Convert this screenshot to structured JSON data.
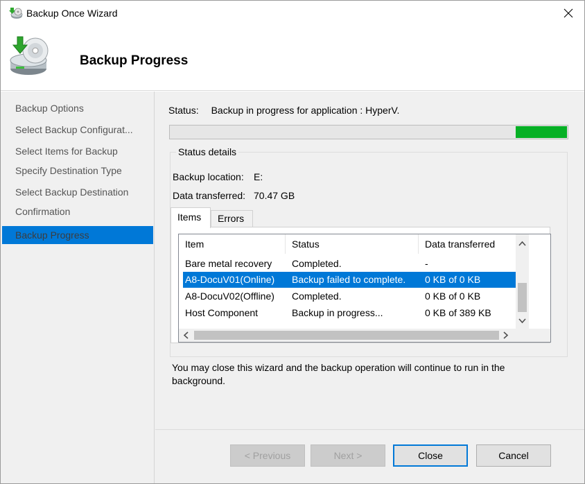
{
  "window": {
    "title": "Backup Once Wizard",
    "close_glyph": "✕"
  },
  "header": {
    "title": "Backup Progress",
    "icon": "backup-disk-icon"
  },
  "nav": {
    "items": [
      {
        "label": "Backup Options",
        "active": false
      },
      {
        "label": "Select Backup Configurat...",
        "active": false
      },
      {
        "label": "Select Items for Backup",
        "active": false
      },
      {
        "label": "Specify Destination Type",
        "active": false
      },
      {
        "label": "Select Backup Destination",
        "active": false
      },
      {
        "label": "Confirmation",
        "active": false
      },
      {
        "label": "Backup Progress",
        "active": true
      }
    ]
  },
  "status": {
    "label": "Status:",
    "value": "Backup in progress for application : HyperV.",
    "progress_segment_start": 0.87,
    "progress_segment_end": 1.0,
    "progress_color": "#06b025"
  },
  "details": {
    "title": "Status details",
    "location_label": "Backup location:",
    "location_value": "E:",
    "transferred_label": "Data transferred:",
    "transferred_value": "70.47 GB"
  },
  "tabs": [
    {
      "label": "Items",
      "selected": true
    },
    {
      "label": "Errors",
      "selected": false
    }
  ],
  "table": {
    "columns": [
      "Item",
      "Status",
      "Data transferred"
    ],
    "rows": [
      {
        "item": "Bare metal recovery",
        "status": "Completed.",
        "data": "-",
        "selected": false
      },
      {
        "item": "A8-DocuV01(Online)",
        "status": "Backup failed to complete.",
        "data": "0 KB of 0 KB",
        "selected": true
      },
      {
        "item": "A8-DocuV02(Offline)",
        "status": "Completed.",
        "data": "0 KB of 0 KB",
        "selected": false
      },
      {
        "item": "Host Component",
        "status": "Backup in progress...",
        "data": "0 KB of 389 KB",
        "selected": false
      }
    ]
  },
  "note": "You may close this wizard and the backup operation will continue to run in the background.",
  "buttons": {
    "previous": "< Previous",
    "next": "Next >",
    "close": "Close",
    "cancel": "Cancel"
  },
  "colors": {
    "accent": "#0078d7",
    "panel": "#f0f0f0"
  }
}
